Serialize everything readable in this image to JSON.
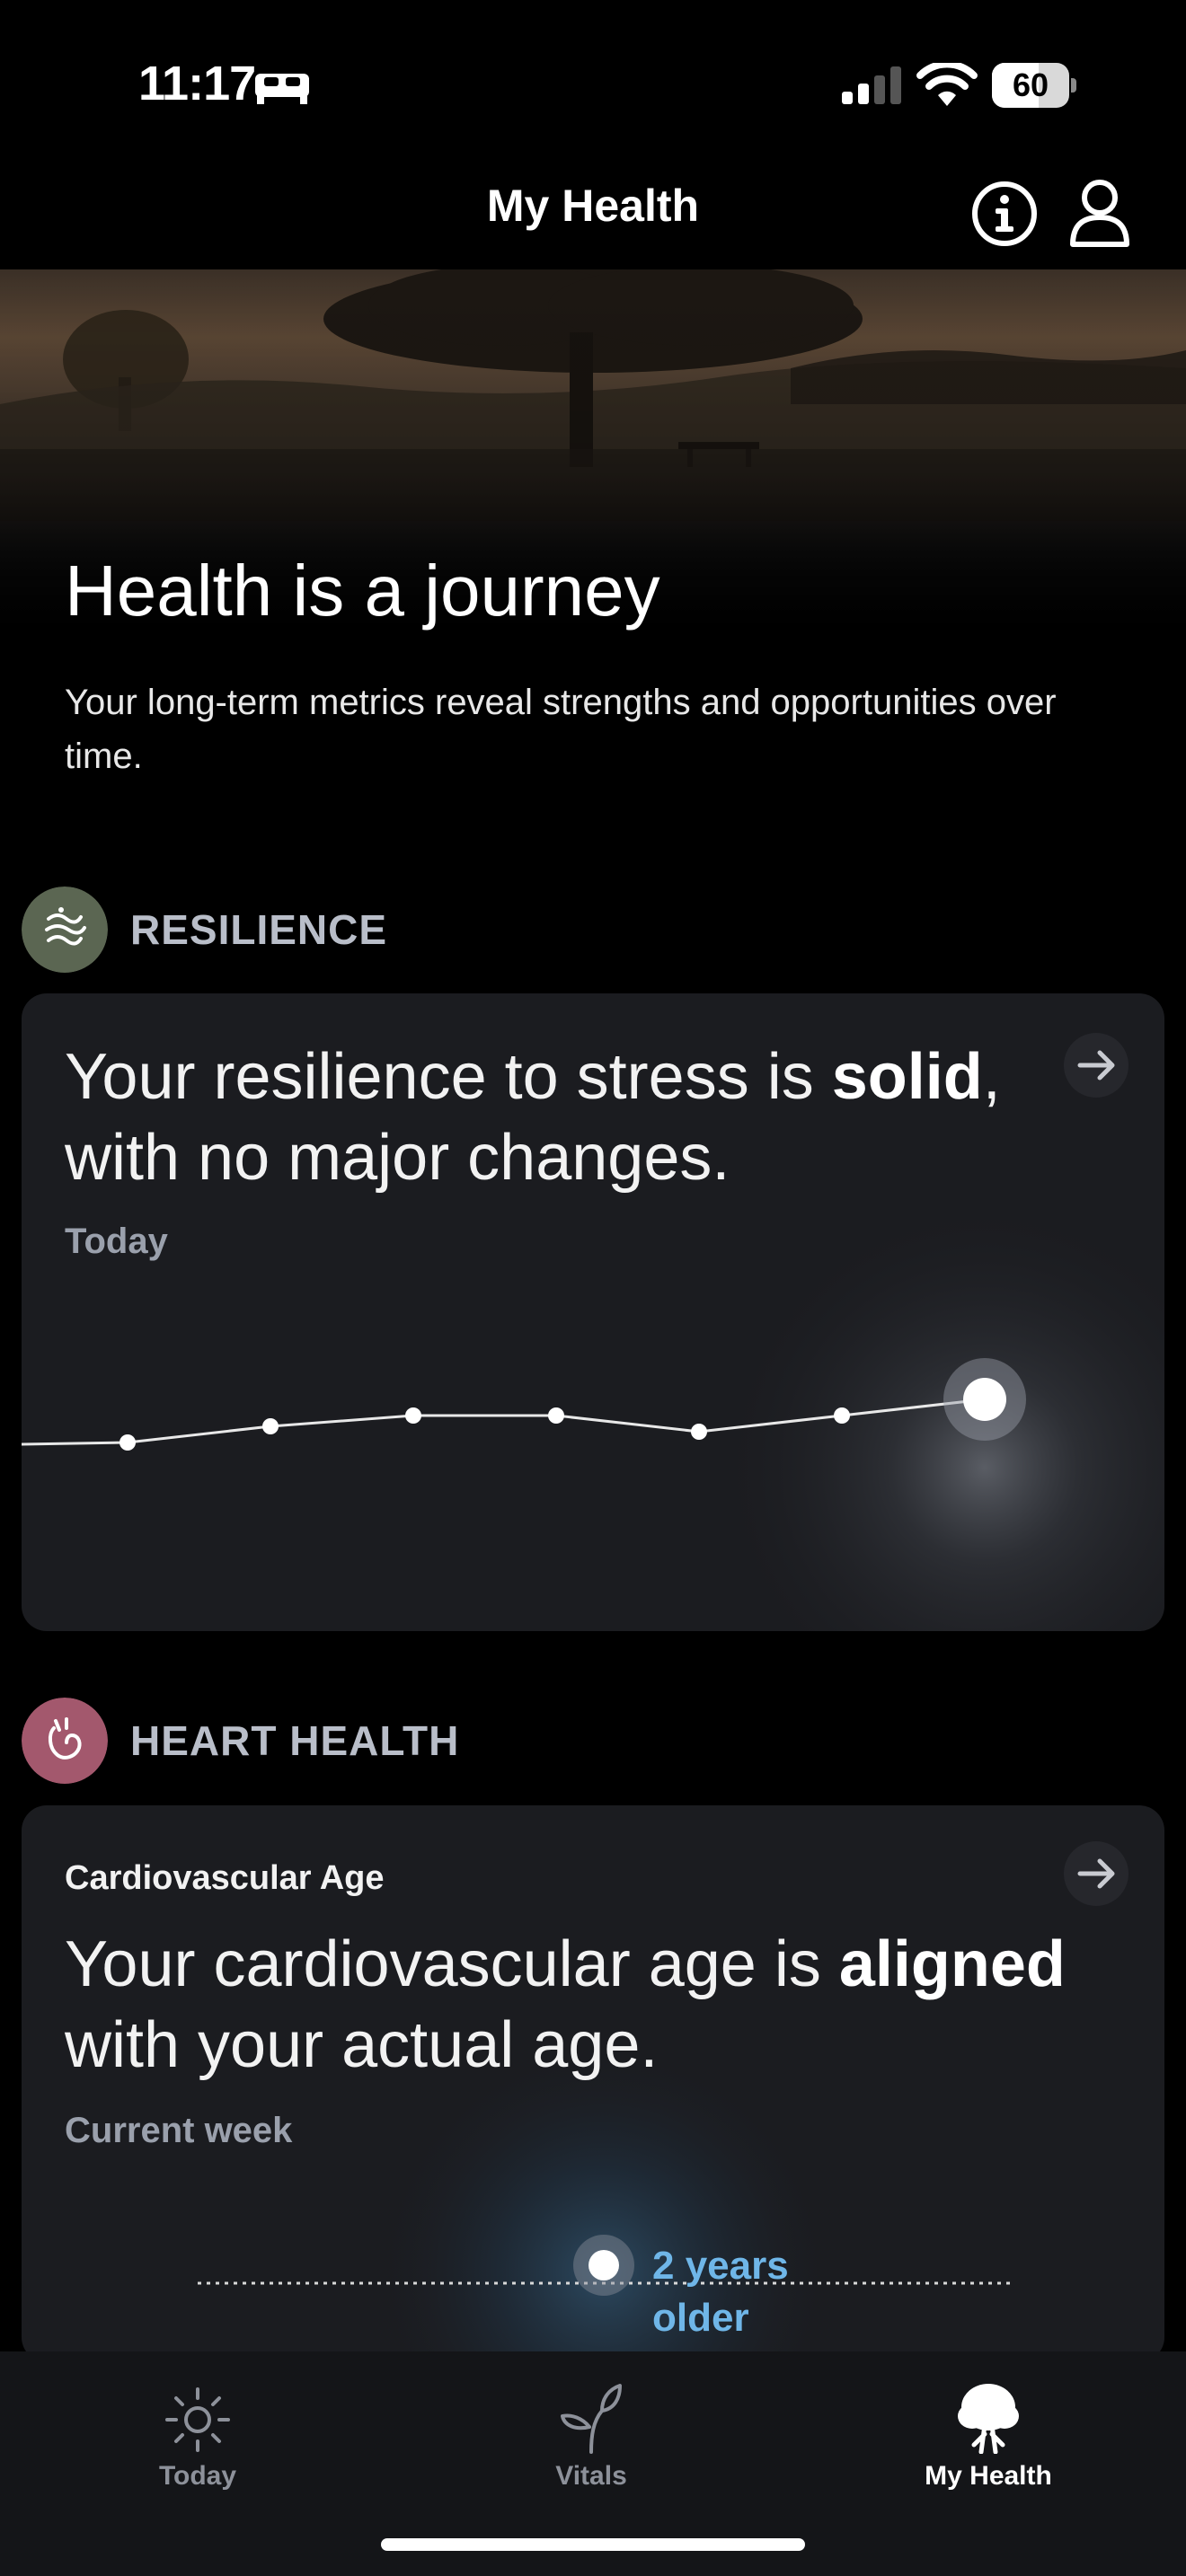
{
  "status_bar": {
    "time": "11:17",
    "battery_percent": "60",
    "battery_level": 0.6,
    "icons": [
      "bed-icon",
      "cellular-signal-icon",
      "wifi-icon",
      "battery-icon"
    ]
  },
  "header": {
    "title": "My Health",
    "icons": [
      "info-icon",
      "profile-icon"
    ]
  },
  "hero": {
    "title": "Health is a journey",
    "subtitle": "Your long-term metrics reveal strengths and opportunities over time."
  },
  "resilience": {
    "section_label": "RESILIENCE",
    "section_icon": "wind-waves-icon",
    "section_color": "#5b6652",
    "headline_before": "Your resilience to stress is ",
    "headline_bold": "solid",
    "headline_after": ", with no major changes.",
    "period": "Today",
    "trend_level": [
      0.5,
      0.53,
      0.55,
      0.55,
      0.52,
      0.55,
      0.58
    ],
    "highlight_index": 6
  },
  "heart_health": {
    "section_label": "HEART HEALTH",
    "section_icon": "heart-hand-icon",
    "section_color": "#a3586d",
    "card_title": "Cardiovascular Age",
    "headline_before": "Your cardiovascular age is ",
    "headline_bold": "aligned",
    "headline_after": " with your actual age.",
    "period": "Current week",
    "marker_label_line1": "2 years",
    "marker_label_line2": "older",
    "accent_color": "#6fb6e8"
  },
  "nav": {
    "items": [
      {
        "label": "Today",
        "icon": "sun-icon",
        "active": false
      },
      {
        "label": "Vitals",
        "icon": "sprout-icon",
        "active": false
      },
      {
        "label": "My Health",
        "icon": "tree-icon",
        "active": true
      }
    ]
  }
}
